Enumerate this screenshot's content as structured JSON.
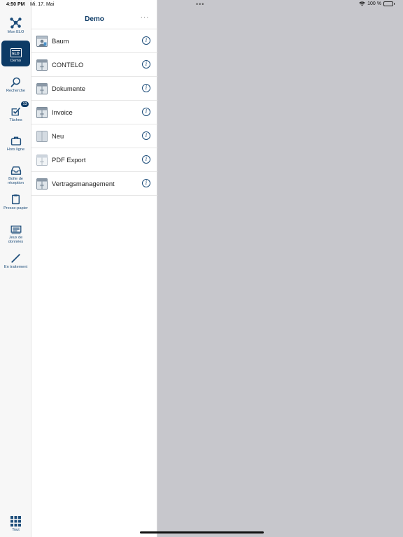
{
  "status_bar": {
    "time": "4:50 PM",
    "date": "Mi. 17. Mai",
    "dots": "•••",
    "battery": "100 %"
  },
  "nav": {
    "items": [
      {
        "label": "Mon ELO"
      },
      {
        "label": "Demo",
        "icon_text": "ELO",
        "active": true
      },
      {
        "label": "Recherche"
      },
      {
        "label": "Tâches",
        "badge": "13"
      },
      {
        "label": "Hors ligne"
      },
      {
        "label": "Boîte de réception"
      },
      {
        "label": "Presse-papier"
      },
      {
        "label": "Jeux de données"
      },
      {
        "label": "En traitement"
      },
      {
        "label": "Tout"
      }
    ]
  },
  "list": {
    "title": "Demo",
    "more": "···",
    "info_glyph": "i",
    "items": [
      {
        "label": "Baum",
        "icon": "tree-archive-icon"
      },
      {
        "label": "CONTELO",
        "icon": "binder-icon"
      },
      {
        "label": "Dokumente",
        "icon": "binder-icon"
      },
      {
        "label": "Invoice",
        "icon": "binder-icon"
      },
      {
        "label": "Neu",
        "icon": "binder-light-icon"
      },
      {
        "label": "PDF Export",
        "icon": "binder-faded-icon"
      },
      {
        "label": "Vertragsmanagement",
        "icon": "binder-icon"
      }
    ]
  },
  "colors": {
    "accent": "#0d3b66",
    "icon_blue": "#1d4d7a",
    "background": "#c7c7cc"
  }
}
